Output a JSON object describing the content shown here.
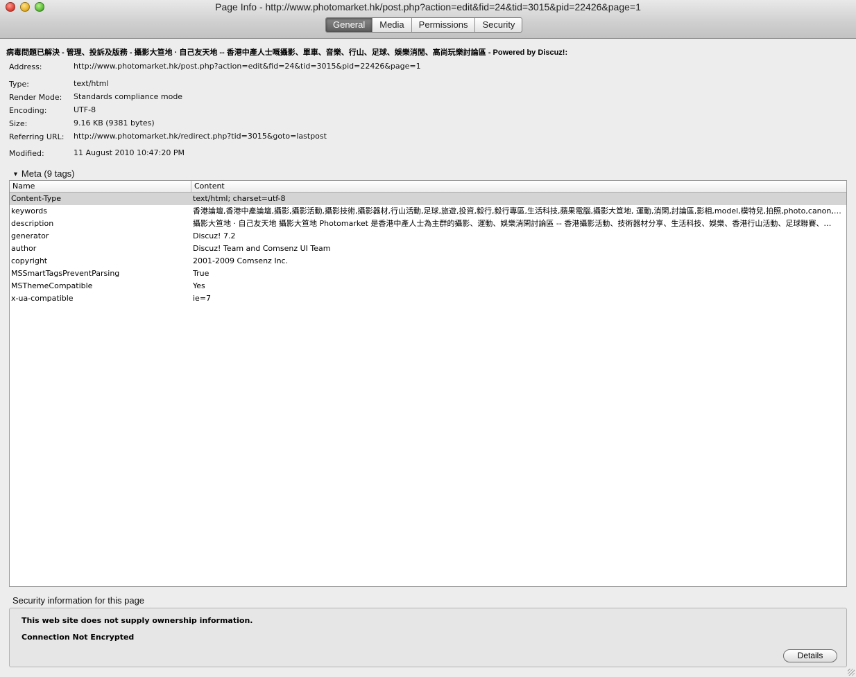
{
  "window": {
    "title": "Page Info - http://www.photomarket.hk/post.php?action=edit&fid=24&tid=3015&pid=22426&page=1"
  },
  "tabs": [
    {
      "label": "General",
      "active": true
    },
    {
      "label": "Media",
      "active": false
    },
    {
      "label": "Permissions",
      "active": false
    },
    {
      "label": "Security",
      "active": false
    }
  ],
  "general": {
    "page_title": "病毒問題已解決 - 管理、投訴及版務 - 攝影大笪地 · 自己友天地 -- 香港中產人士嘅攝影、單車、音樂、行山、足球、娛樂消閒、高尚玩樂討論區 - Powered by Discuz!:",
    "address_label": "Address:",
    "address": "http://www.photomarket.hk/post.php?action=edit&fid=24&tid=3015&pid=22426&page=1",
    "type_label": "Type:",
    "type": "text/html",
    "render_mode_label": "Render Mode:",
    "render_mode": "Standards compliance mode",
    "encoding_label": "Encoding:",
    "encoding": "UTF-8",
    "size_label": "Size:",
    "size": "9.16 KB (9381 bytes)",
    "referring_url_label": "Referring URL:",
    "referring_url": "http://www.photomarket.hk/redirect.php?tid=3015&goto=lastpost",
    "modified_label": "Modified:",
    "modified": "11 August 2010 10:47:20 PM"
  },
  "meta": {
    "header": "Meta (9 tags)",
    "columns": {
      "name": "Name",
      "content": "Content"
    },
    "rows": [
      {
        "name": "Content-Type",
        "content": "text/html; charset=utf-8"
      },
      {
        "name": "keywords",
        "content": " 香港論壇,香港中產論壇,攝影,攝影活動,攝影技術,攝影器材,行山活動,足球,旅遊,投資,毅行,毅行專區,生活科技,蘋果電腦,攝影大笪地, 運動,消閑,討論區,影相,model,模特兒,拍照,photo,canon,…"
      },
      {
        "name": "description",
        "content": " 攝影大笪地 · 自己友天地  攝影大笪地 Photomarket 是香港中產人士為主群的攝影、運動、娛樂消閑討論區 -- 香港攝影活動、技術器材分享、生活科技、娛樂、香港行山活動、足球聯賽、…"
      },
      {
        "name": "generator",
        "content": "Discuz! 7.2"
      },
      {
        "name": "author",
        "content": "Discuz! Team and Comsenz UI Team"
      },
      {
        "name": "copyright",
        "content": "2001-2009 Comsenz Inc."
      },
      {
        "name": "MSSmartTagsPreventParsing",
        "content": "True"
      },
      {
        "name": "MSThemeCompatible",
        "content": "Yes"
      },
      {
        "name": "x-ua-compatible",
        "content": "ie=7"
      }
    ]
  },
  "security": {
    "label": "Security information for this page",
    "ownership": "This web site does not supply ownership information.",
    "connection": "Connection Not Encrypted",
    "details_button": "Details"
  }
}
